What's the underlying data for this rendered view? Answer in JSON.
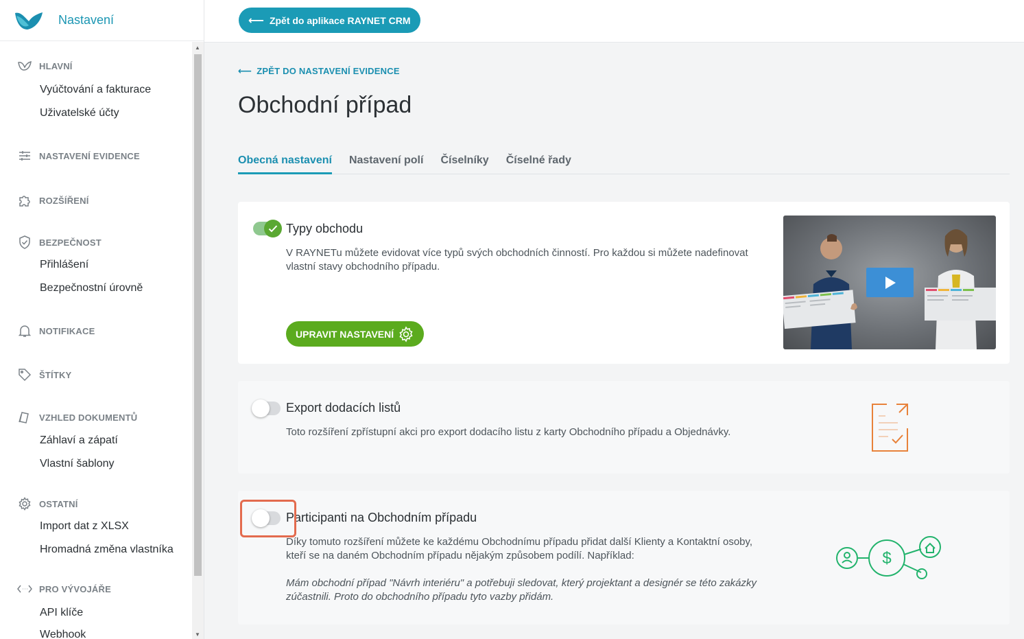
{
  "sidebar": {
    "title": "Nastavení",
    "sections": [
      {
        "title": "HLAVNÍ",
        "icon": "raynet-icon",
        "items": [
          "Vyúčtování a fakturace",
          "Uživatelské účty"
        ]
      },
      {
        "title": "NASTAVENÍ EVIDENCE",
        "icon": "sliders-icon",
        "items": []
      },
      {
        "title": "ROZŠÍŘENÍ",
        "icon": "puzzle-icon",
        "items": []
      },
      {
        "title": "BEZPEČNOST",
        "icon": "shield-icon",
        "items": [
          "Přihlášení",
          "Bezpečnostní úrovně"
        ]
      },
      {
        "title": "NOTIFIKACE",
        "icon": "bell-icon",
        "items": []
      },
      {
        "title": "ŠTÍTKY",
        "icon": "tag-icon",
        "items": []
      },
      {
        "title": "VZHLED DOKUMENTŮ",
        "icon": "documents-icon",
        "items": [
          "Záhlaví a zápatí",
          "Vlastní šablony"
        ]
      },
      {
        "title": "OSTATNÍ",
        "icon": "gear-icon",
        "items": [
          "Import dat z XLSX",
          "Hromadná změna vlastníka"
        ]
      },
      {
        "title": "PRO VÝVOJÁŘE",
        "icon": "code-icon",
        "items": [
          "API klíče",
          "Webhook"
        ]
      }
    ]
  },
  "topbar": {
    "back_button": "Zpět do aplikace RAYNET CRM"
  },
  "main": {
    "back_link": "ZPĚT DO NASTAVENÍ EVIDENCE",
    "title": "Obchodní případ",
    "tabs": [
      "Obecná nastavení",
      "Nastavení polí",
      "Číselníky",
      "Číselné řady"
    ],
    "active_tab": "Obecná nastavení",
    "cards": [
      {
        "title": "Typy obchodu",
        "enabled": true,
        "description": "V RAYNETu můžete evidovat více typů svých obchodních činností. Pro každou si můžete nadefinovat vlastní stavy obchodního případu.",
        "button": "UPRAVIT NASTAVENÍ"
      },
      {
        "title": "Export dodacích listů",
        "enabled": false,
        "description": "Toto rozšíření zpřístupní akci pro export dodacího listu z karty Obchodního případu a Objednávky."
      },
      {
        "title": "Participanti na Obchodním případu",
        "enabled": false,
        "description": "Díky tomuto rozšíření můžete ke každému Obchodnímu případu přidat další Klienty a Kontaktní osoby, kteří se na daném Obchodním případu nějakým způsobem podílí. Například:",
        "example": "Mám obchodní případ \"Návrh interiéru\" a potřebuji sledovat, který projektant a designér se této zakázky zúčastnili. Proto do obchodního případu tyto vazby přidám."
      }
    ]
  },
  "colors": {
    "accent": "#1b9bb6",
    "green": "#5bab1e",
    "orange": "#e8823a",
    "highlight": "#e36b4e"
  }
}
